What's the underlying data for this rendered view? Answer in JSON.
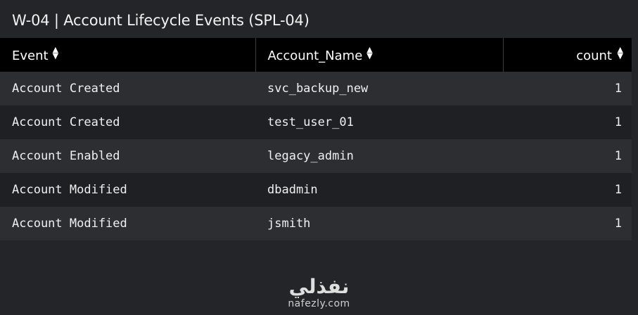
{
  "panel": {
    "title": "W-04 | Account Lifecycle Events (SPL-04)"
  },
  "table": {
    "columns": [
      {
        "label": "Event",
        "sort_icon": "sort-updown-icon"
      },
      {
        "label": "Account_Name",
        "sort_icon": "sort-updown-icon"
      },
      {
        "label": "count",
        "sort_icon": "sort-updown-icon"
      }
    ],
    "rows": [
      {
        "event": "Account Created",
        "account_name": "svc_backup_new",
        "count": "1"
      },
      {
        "event": "Account Created",
        "account_name": "test_user_01",
        "count": "1"
      },
      {
        "event": "Account Enabled",
        "account_name": "legacy_admin",
        "count": "1"
      },
      {
        "event": "Account Modified",
        "account_name": "dbadmin",
        "count": "1"
      },
      {
        "event": "Account Modified",
        "account_name": "jsmith",
        "count": "1"
      }
    ]
  },
  "watermark": {
    "logo_text": "نفذلي",
    "url": "nafezly.com"
  },
  "colors": {
    "header_bg": "#000000",
    "row_odd": "#2c2e32",
    "row_even": "#1e2023",
    "panel_bg": "#232528"
  }
}
